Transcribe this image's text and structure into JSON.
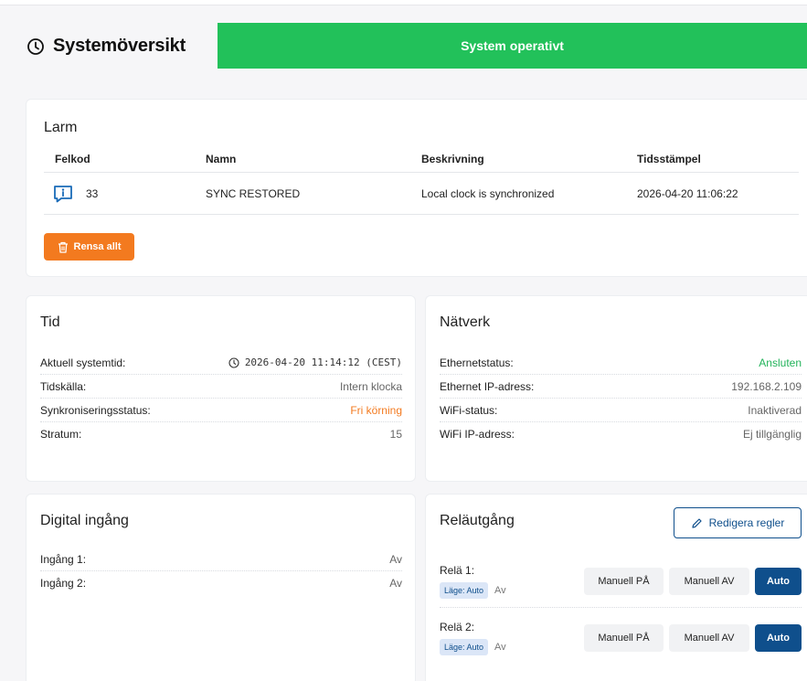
{
  "header": {
    "title": "Systemöversikt",
    "status_text": "System operativt"
  },
  "colors": {
    "status_ok": "#22c15a",
    "accent": "#0f4f8c",
    "warning": "#f37a1f",
    "success_text": "#22b35a",
    "alarm_icon": "#1a6bb8"
  },
  "alarms": {
    "title": "Larm",
    "columns": [
      "Felkod",
      "Namn",
      "Beskrivning",
      "Tidsstämpel"
    ],
    "rows": [
      {
        "icon": "info-message-icon",
        "code": "33",
        "name": "SYNC RESTORED",
        "description": "Local clock is synchronized",
        "timestamp": "2026-04-20 11:06:22"
      }
    ],
    "clear_label": "Rensa allt"
  },
  "time": {
    "title": "Tid",
    "rows": [
      {
        "label": "Aktuell systemtid:",
        "value": "2026-04-20 11:14:12 (CEST)"
      },
      {
        "label": "Tidskälla:",
        "value": "Intern klocka"
      },
      {
        "label": "Synkroniseringsstatus:",
        "value": "Fri körning"
      },
      {
        "label": "Stratum:",
        "value": "15"
      }
    ]
  },
  "network": {
    "title": "Nätverk",
    "rows": [
      {
        "label": "Ethernetstatus:",
        "value": "Ansluten"
      },
      {
        "label": "Ethernet IP-adress:",
        "value": "192.168.2.109"
      },
      {
        "label": "WiFi-status:",
        "value": "Inaktiverad"
      },
      {
        "label": "WiFi IP-adress:",
        "value": "Ej tillgänglig"
      }
    ]
  },
  "digital_input": {
    "title": "Digital ingång",
    "rows": [
      {
        "label": "Ingång 1:",
        "value": "Av"
      },
      {
        "label": "Ingång 2:",
        "value": "Av"
      }
    ]
  },
  "relay_output": {
    "title": "Reläutgång",
    "edit_label": "Redigera regler",
    "relays": [
      {
        "name": "Relä 1:",
        "mode": "Läge: Auto",
        "state": "Av",
        "btn_on": "Manuell PÅ",
        "btn_off": "Manuell AV",
        "btn_auto": "Auto"
      },
      {
        "name": "Relä 2:",
        "mode": "Läge: Auto",
        "state": "Av",
        "btn_on": "Manuell PÅ",
        "btn_off": "Manuell AV",
        "btn_auto": "Auto"
      }
    ]
  }
}
